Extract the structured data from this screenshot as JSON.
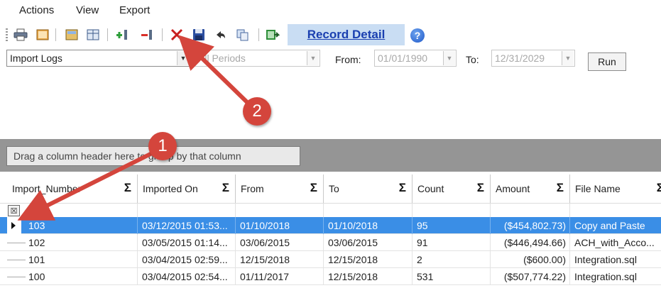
{
  "menu": {
    "items": [
      "Actions",
      "View",
      "Export"
    ]
  },
  "toolbar": {
    "icons": [
      "print-icon",
      "page-setup-icon",
      "layout-icon",
      "grid-icon",
      "add-record-icon",
      "remove-record-icon",
      "delete-icon",
      "save-icon",
      "undo-icon",
      "copy-icon",
      "export-icon"
    ],
    "record_detail_label": "Record Detail",
    "help_glyph": "?"
  },
  "filters": {
    "log_type_value": "Import Logs",
    "period_value": "All Periods",
    "from_label": "From:",
    "from_value": "01/01/1990",
    "to_label": "To:",
    "to_value": "12/31/2029",
    "run_label": "Run"
  },
  "grid": {
    "group_hint": "Drag a column header here to group by that column",
    "columns": [
      "Import_Number",
      "Imported On",
      "From",
      "To",
      "Count",
      "Amount",
      "File Name"
    ],
    "sigma": "Σ",
    "rows": [
      [
        "103",
        "03/12/2015  01:53...",
        "01/10/2018",
        "01/10/2018",
        "95",
        "($454,802.73)",
        "Copy and Paste"
      ],
      [
        "102",
        "03/05/2015  01:14...",
        "03/06/2015",
        "03/06/2015",
        "91",
        "($446,494.66)",
        "ACH_with_Acco..."
      ],
      [
        "101",
        "03/04/2015  02:59...",
        "12/15/2018",
        "12/15/2018",
        "2",
        "($600.00)",
        "Integration.sql"
      ],
      [
        "100",
        "03/04/2015  02:54...",
        "01/11/2017",
        "12/15/2018",
        "531",
        "($507,774.22)",
        "Integration.sql"
      ]
    ],
    "selected_row": 0
  },
  "annotations": {
    "badge1": "1",
    "badge2": "2",
    "color": "#d4453c"
  }
}
